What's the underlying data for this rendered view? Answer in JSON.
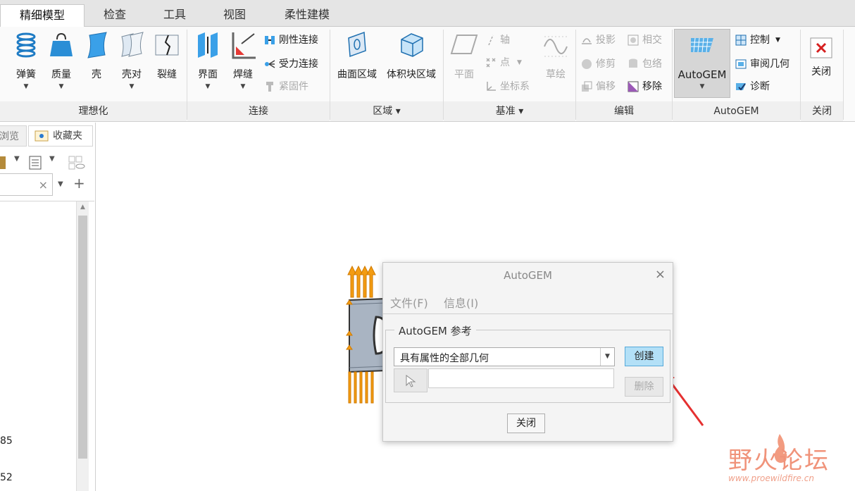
{
  "tabs": [
    "精细模型",
    "检查",
    "工具",
    "视图",
    "柔性建模"
  ],
  "ribbon": {
    "ideal": {
      "group": "理想化",
      "items": [
        "弹簧",
        "质量",
        "壳",
        "壳对",
        "裂缝"
      ]
    },
    "conn": {
      "group": "连接",
      "items": [
        "界面",
        "焊缝"
      ],
      "small": [
        "刚性连接",
        "受力连接",
        "紧固件"
      ]
    },
    "region": {
      "group": "区域",
      "items": [
        "曲面区域",
        "体积块区域"
      ]
    },
    "datum": {
      "group": "基准",
      "items": [
        "平面",
        "草绘"
      ],
      "small": [
        "轴",
        "点",
        "坐标系"
      ]
    },
    "edit": {
      "group": "编辑",
      "small": [
        "投影",
        "相交",
        "修剪",
        "包络",
        "偏移",
        "移除"
      ]
    },
    "autogem": {
      "group": "AutoGEM",
      "big": "AutoGEM",
      "small": [
        "控制",
        "审阅几何",
        "诊断"
      ]
    },
    "close": {
      "group": "关闭",
      "label": "关闭"
    }
  },
  "leftpanel": {
    "tab1": "浏览",
    "tab2": "收藏夹",
    "num1": "85",
    "num2": "52"
  },
  "dialog": {
    "title": "AutoGEM",
    "menu": [
      "文件(F)",
      "信息(I)"
    ],
    "section": "AutoGEM 参考",
    "select_value": "具有属性的全部几何",
    "create": "创建",
    "delete": "删除",
    "close": "关闭"
  },
  "watermark": {
    "text": "野火论坛",
    "url": "www.proewildfire.cn"
  }
}
